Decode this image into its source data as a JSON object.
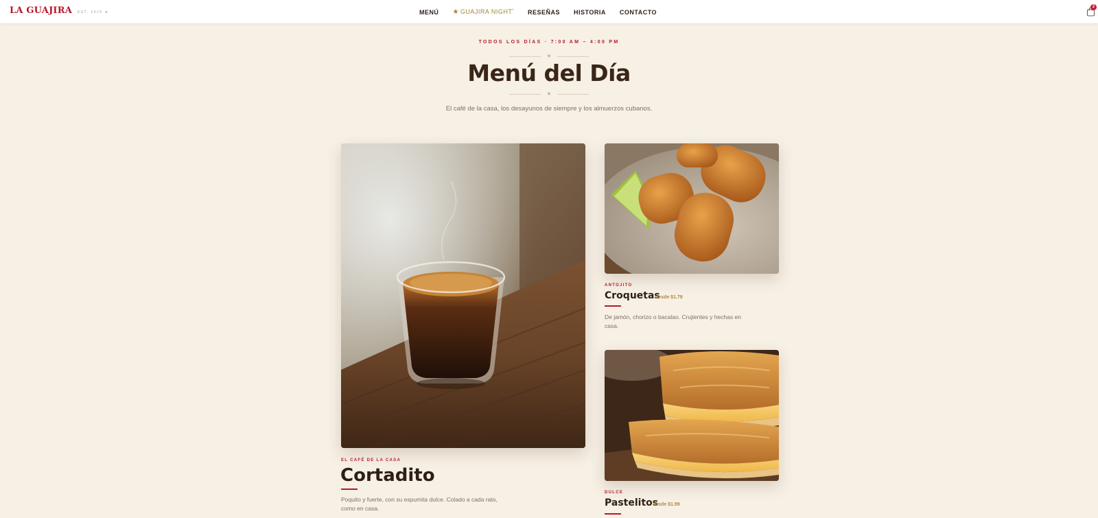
{
  "nav": {
    "brand": "LA GUAJIRA",
    "brand_est": "EST. 2015 ★",
    "links": [
      "MENÚ",
      "GUAJIRA NIGHT",
      "RESEÑAS",
      "HISTORIA",
      "CONTACTO"
    ],
    "special_star": "★",
    "special_dot": "•",
    "cart_count": "2"
  },
  "header": {
    "eyebrow": "TODOS LOS DÍAS · 7:00 AM – 4:00 PM",
    "ornament": "★",
    "title": "Menú del Día",
    "subtitle": "El café de la casa, los desayunos de siempre y los almuerzos cubanos."
  },
  "items": [
    {
      "kicker": "EL CAFÉ DE LA CASA",
      "name": "Cortadito",
      "price": "",
      "description": "Poquito y fuerte, con su espumita dulce. Colado a cada rato, como en casa."
    },
    {
      "kicker": "ANTOJITO",
      "name": "Croquetas",
      "price": "desde $1.79",
      "description": "De jamón, chorizo o bacalao. Crujientes y hechas en casa."
    },
    {
      "kicker": "DULCE",
      "name": "Pastelitos",
      "price": "desde $1.99",
      "description": ""
    }
  ],
  "colors": {
    "background": "#f7f0e5",
    "accent_red": "#b5182b",
    "accent_gold": "#b08a3e",
    "text_dark": "#3a2618"
  },
  "icons": {
    "cart": "shopping-bag-icon",
    "ornament": "star-icon"
  }
}
